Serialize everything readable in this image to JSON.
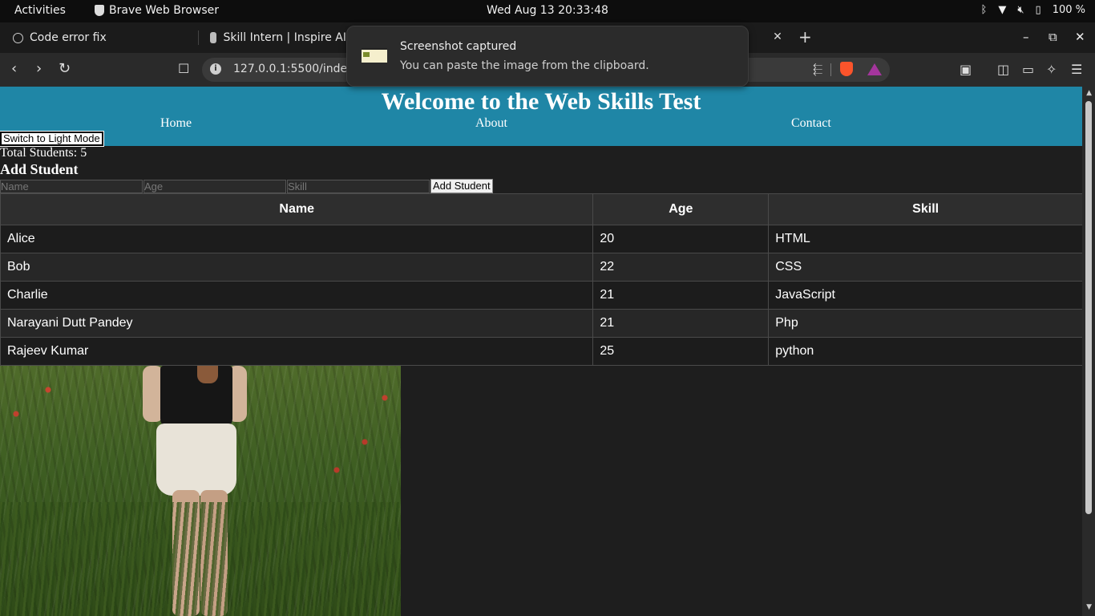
{
  "system_bar": {
    "activities": "Activities",
    "app_name": "Brave Web Browser",
    "clock": "Wed Aug 13  20:33:48",
    "battery": "100 %"
  },
  "tabs": [
    {
      "label": "Code error fix",
      "icon": "openai-icon"
    },
    {
      "label": "Skill Intern | Inspire AI",
      "icon": "site-favicon"
    }
  ],
  "address_bar": {
    "url": "127.0.0.1:5500/index.h"
  },
  "notification": {
    "title": "Screenshot captured",
    "body": "You can paste the image from the clipboard."
  },
  "page": {
    "header_title": "Welcome to the Web Skills Test",
    "nav": [
      "Home",
      "About",
      "Contact"
    ],
    "theme_toggle_label": "Switch to Light Mode",
    "total_students": "Total Students: 5",
    "add_heading": "Add Student",
    "form": {
      "name_placeholder": "Name",
      "age_placeholder": "Age",
      "skill_placeholder": "Skill",
      "submit_label": "Add Student"
    },
    "table": {
      "headers": [
        "Name",
        "Age",
        "Skill"
      ],
      "rows": [
        [
          "Alice",
          "20",
          "HTML"
        ],
        [
          "Bob",
          "22",
          "CSS"
        ],
        [
          "Charlie",
          "21",
          "JavaScript"
        ],
        [
          "Narayani Dutt Pandey",
          "21",
          "Php"
        ],
        [
          "Rajeev Kumar",
          "25",
          "python"
        ]
      ]
    }
  },
  "colors": {
    "header_bg": "#1f86a6",
    "page_bg": "#1e1e1e"
  }
}
